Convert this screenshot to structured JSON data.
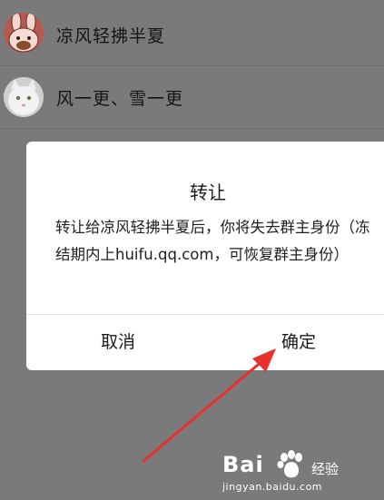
{
  "contacts": [
    {
      "name": "凉风轻拂半夏",
      "avatar_color": "#b45b4e",
      "avatar_icon": "cartoon-rabbit-avatar"
    },
    {
      "name": "风一更、雪一更",
      "avatar_color": "#dcdcdc",
      "avatar_icon": "white-cat-avatar"
    }
  ],
  "dialog": {
    "title": "转让",
    "message": "转让给凉风轻拂半夏后，你将失去群主身份（冻结期内上huifu.qq.com，可恢复群主身份）",
    "cancel_label": "取消",
    "confirm_label": "确定"
  },
  "annotation": {
    "color": "#e8302e",
    "icon": "red-arrow-pointing-to-confirm"
  },
  "watermark": {
    "brand": "Bai",
    "icon": "baidu-paw-icon",
    "brand_suffix": "经验",
    "url": "jingyan.baidu.com"
  }
}
